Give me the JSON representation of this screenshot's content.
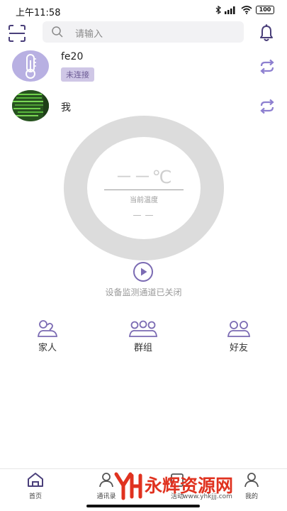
{
  "status_bar": {
    "time": "上午11:58",
    "battery": "100"
  },
  "search": {
    "placeholder": "请输入"
  },
  "devices": [
    {
      "name": "fe20",
      "status": "未连接"
    },
    {
      "name": "我"
    }
  ],
  "gauge": {
    "temperature": "－－℃",
    "label": "当前温度",
    "value": "－－"
  },
  "monitor": {
    "text": "设备监测通道已关闭"
  },
  "quick_actions": [
    {
      "label": "家人",
      "icon": "family-icon"
    },
    {
      "label": "群组",
      "icon": "group-icon"
    },
    {
      "label": "好友",
      "icon": "friends-icon"
    }
  ],
  "tabs": [
    {
      "label": "首页",
      "icon": "home-icon"
    },
    {
      "label": "通讯录",
      "icon": "contacts-icon"
    },
    {
      "label": "活动",
      "icon": "activity-icon"
    },
    {
      "label": "我的",
      "icon": "profile-icon"
    }
  ],
  "watermark": {
    "text": "永辉资源网",
    "url": "www.yhkjjj.com"
  },
  "colors": {
    "accent": "#7b6bb3",
    "badge_bg": "#cfc7e6",
    "gauge_ring": "#dcdcdc",
    "watermark": "#e0321f"
  }
}
